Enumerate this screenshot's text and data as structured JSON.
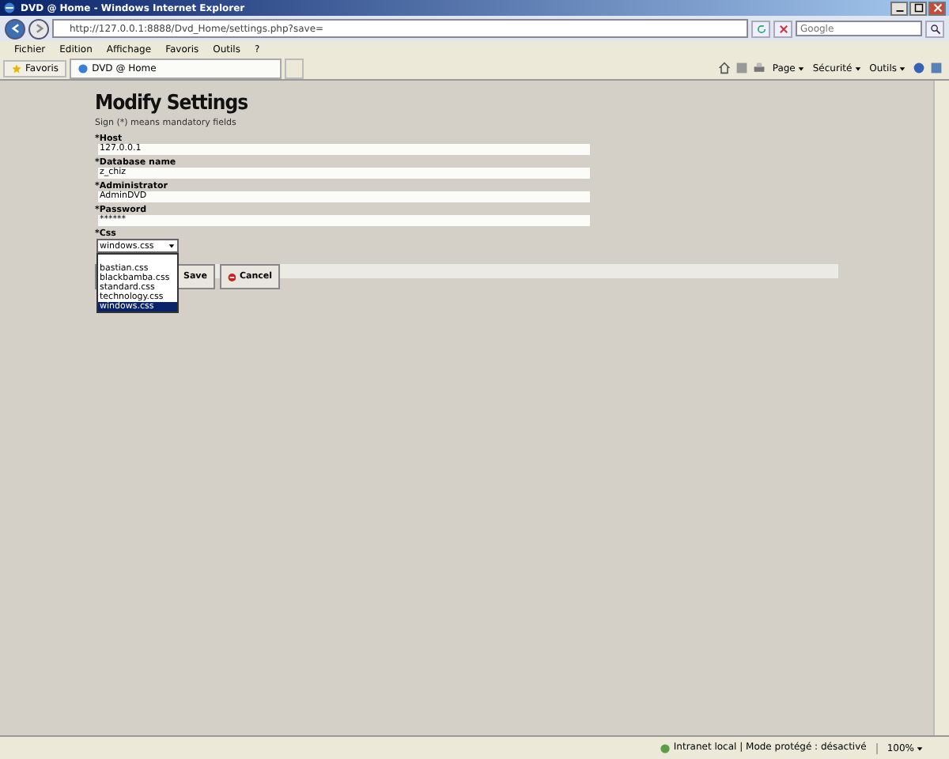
{
  "window": {
    "title": "DVD @ Home - Windows Internet Explorer"
  },
  "address_bar": {
    "url": "http://127.0.0.1:8888/Dvd_Home/settings.php?save="
  },
  "search": {
    "placeholder": "Google"
  },
  "menu": [
    "Fichier",
    "Edition",
    "Affichage",
    "Favoris",
    "Outils",
    "?"
  ],
  "favorites": {
    "label": "Favoris"
  },
  "tabs": [
    {
      "label": "DVD @ Home",
      "selected": true
    }
  ],
  "command_bar": [
    "Page",
    "Sécurité",
    "Outils"
  ],
  "page": {
    "heading": "Modify Settings",
    "note": "Sign (*) means mandatory fields",
    "fields": [
      {
        "label": "*Host",
        "value": "127.0.0.1"
      },
      {
        "label": "*Database name",
        "value": "z_chiz"
      },
      {
        "label": "*Administrator",
        "value": "AdminDVD"
      },
      {
        "label": "*Password",
        "value": "******"
      }
    ],
    "css": {
      "label": "*Css",
      "value": "windows.css",
      "expanded": true,
      "options": [
        {
          "label": "bastian.css",
          "selected": false
        },
        {
          "label": "blackbamba.css",
          "selected": false
        },
        {
          "label": "standard.css",
          "selected": false
        },
        {
          "label": "technology.css",
          "selected": false
        },
        {
          "label": "windows.css",
          "selected": true
        }
      ]
    },
    "buttons": [
      {
        "kind": "save",
        "label": "Save"
      },
      {
        "kind": "cancel",
        "label": "Cancel"
      }
    ]
  },
  "status_bar": {
    "zone": "Intranet local | Mode protégé : désactivé",
    "zoom": "100%"
  }
}
